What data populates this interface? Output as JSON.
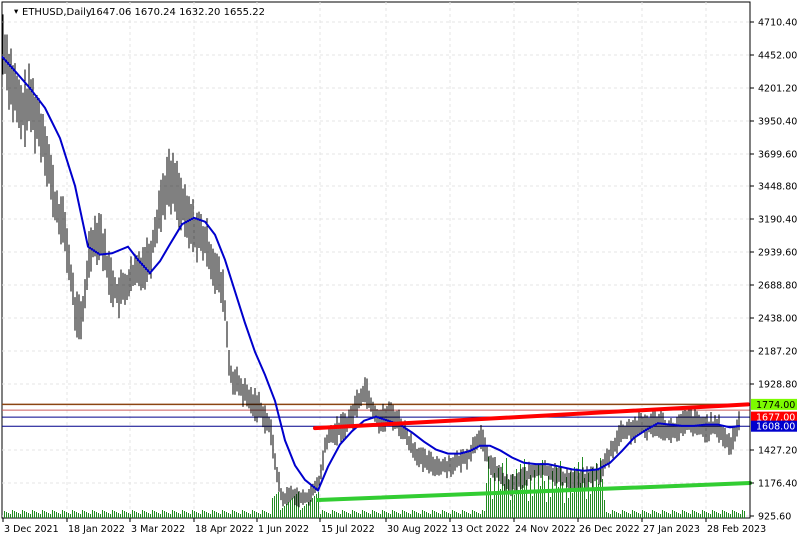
{
  "window": {
    "symbol_label": "ETHUSD,Daily",
    "ohlc": "1647.06 1670.24 1632.20 1655.22"
  },
  "colors": {
    "candle": "#000000",
    "ma": "#0000cd",
    "red_trendline": "#ff0000",
    "green_trendline": "#32cd32",
    "volume": "#228b22",
    "resistance_line": "#8b4513",
    "thin_red_line": "#cd5c5c",
    "blue_line": "#00008b",
    "price_box_green": "#7cfc00",
    "price_box_red": "#ff0000",
    "price_box_blue": "#0000cd",
    "grid": "#e4e4e4"
  },
  "chart_data": {
    "type": "candlestick",
    "title": "ETHUSD,Daily",
    "x_tick_labels": [
      "3 Dec 2021",
      "18 Jan 2022",
      "3 Mar 2022",
      "18 Apr 2022",
      "1 Jun 2022",
      "15 Jul 2022",
      "30 Aug 2022",
      "13 Oct 2022",
      "24 Nov 2022",
      "26 Dec 2022",
      "27 Jan 2023",
      "28 Feb 2023"
    ],
    "y_tick_labels": [
      "4710.40",
      "4452.00",
      "4201.20",
      "3950.40",
      "3699.60",
      "3448.80",
      "3190.40",
      "2939.60",
      "2688.80",
      "2438.00",
      "2187.20",
      "1928.80",
      "1427.20",
      "1176.40",
      "925.60"
    ],
    "ylim": [
      925.6,
      4710.4
    ],
    "price_path": [
      [
        0,
        4650
      ],
      [
        10,
        4300
      ],
      [
        20,
        4000
      ],
      [
        30,
        4100
      ],
      [
        45,
        3800
      ],
      [
        55,
        3300
      ],
      [
        65,
        3100
      ],
      [
        75,
        2500
      ],
      [
        82,
        2400
      ],
      [
        90,
        3000
      ],
      [
        100,
        3100
      ],
      [
        108,
        2800
      ],
      [
        118,
        2600
      ],
      [
        128,
        2700
      ],
      [
        138,
        2800
      ],
      [
        150,
        2900
      ],
      [
        160,
        3300
      ],
      [
        168,
        3500
      ],
      [
        176,
        3450
      ],
      [
        186,
        3200
      ],
      [
        196,
        3100
      ],
      [
        206,
        3000
      ],
      [
        216,
        2800
      ],
      [
        224,
        2600
      ],
      [
        230,
        2000
      ],
      [
        240,
        1900
      ],
      [
        250,
        1800
      ],
      [
        260,
        1750
      ],
      [
        270,
        1600
      ],
      [
        276,
        1300
      ],
      [
        282,
        1050
      ],
      [
        292,
        1100
      ],
      [
        302,
        1050
      ],
      [
        312,
        1100
      ],
      [
        320,
        1200
      ],
      [
        326,
        1500
      ],
      [
        334,
        1550
      ],
      [
        342,
        1600
      ],
      [
        350,
        1650
      ],
      [
        358,
        1800
      ],
      [
        366,
        1900
      ],
      [
        372,
        1750
      ],
      [
        380,
        1650
      ],
      [
        392,
        1700
      ],
      [
        402,
        1600
      ],
      [
        412,
        1450
      ],
      [
        422,
        1350
      ],
      [
        432,
        1320
      ],
      [
        442,
        1300
      ],
      [
        452,
        1320
      ],
      [
        462,
        1350
      ],
      [
        470,
        1400
      ],
      [
        480,
        1550
      ],
      [
        488,
        1350
      ],
      [
        498,
        1250
      ],
      [
        508,
        1150
      ],
      [
        520,
        1200
      ],
      [
        530,
        1250
      ],
      [
        540,
        1280
      ],
      [
        550,
        1270
      ],
      [
        560,
        1220
      ],
      [
        570,
        1210
      ],
      [
        580,
        1200
      ],
      [
        590,
        1220
      ],
      [
        600,
        1250
      ],
      [
        610,
        1400
      ],
      [
        620,
        1550
      ],
      [
        630,
        1580
      ],
      [
        640,
        1600
      ],
      [
        650,
        1620
      ],
      [
        660,
        1640
      ],
      [
        670,
        1560
      ],
      [
        680,
        1600
      ],
      [
        690,
        1650
      ],
      [
        700,
        1600
      ],
      [
        710,
        1600
      ],
      [
        720,
        1580
      ],
      [
        730,
        1450
      ],
      [
        740,
        1650
      ]
    ],
    "moving_average": [
      [
        2,
        4440
      ],
      [
        15,
        4330
      ],
      [
        30,
        4200
      ],
      [
        45,
        4050
      ],
      [
        60,
        3820
      ],
      [
        75,
        3450
      ],
      [
        88,
        2980
      ],
      [
        100,
        2920
      ],
      [
        112,
        2930
      ],
      [
        128,
        2980
      ],
      [
        138,
        2880
      ],
      [
        150,
        2780
      ],
      [
        160,
        2870
      ],
      [
        170,
        3000
      ],
      [
        182,
        3150
      ],
      [
        194,
        3200
      ],
      [
        205,
        3170
      ],
      [
        215,
        3070
      ],
      [
        225,
        2880
      ],
      [
        235,
        2640
      ],
      [
        245,
        2400
      ],
      [
        255,
        2180
      ],
      [
        265,
        2000
      ],
      [
        275,
        1800
      ],
      [
        285,
        1500
      ],
      [
        295,
        1310
      ],
      [
        305,
        1200
      ],
      [
        318,
        1120
      ],
      [
        328,
        1300
      ],
      [
        340,
        1470
      ],
      [
        352,
        1570
      ],
      [
        364,
        1650
      ],
      [
        376,
        1680
      ],
      [
        388,
        1650
      ],
      [
        400,
        1620
      ],
      [
        412,
        1560
      ],
      [
        424,
        1490
      ],
      [
        436,
        1430
      ],
      [
        448,
        1400
      ],
      [
        460,
        1400
      ],
      [
        470,
        1420
      ],
      [
        480,
        1460
      ],
      [
        490,
        1460
      ],
      [
        500,
        1425
      ],
      [
        512,
        1370
      ],
      [
        524,
        1330
      ],
      [
        536,
        1320
      ],
      [
        548,
        1320
      ],
      [
        560,
        1300
      ],
      [
        572,
        1280
      ],
      [
        584,
        1270
      ],
      [
        598,
        1280
      ],
      [
        610,
        1330
      ],
      [
        622,
        1420
      ],
      [
        634,
        1520
      ],
      [
        646,
        1580
      ],
      [
        658,
        1630
      ],
      [
        670,
        1620
      ],
      [
        682,
        1610
      ],
      [
        694,
        1610
      ],
      [
        706,
        1620
      ],
      [
        718,
        1620
      ],
      [
        730,
        1600
      ],
      [
        740,
        1610
      ]
    ],
    "trendlines": [
      {
        "color": "red",
        "from": [
          315,
          1593
        ],
        "to": [
          748,
          1774
        ]
      },
      {
        "color": "green",
        "from": [
          318,
          1047
        ],
        "to": [
          750,
          1176
        ]
      }
    ],
    "horizontal_levels": [
      1774.0,
      1677.0,
      1608.0
    ],
    "price_labels": [
      {
        "value": "1774.00",
        "style": "green"
      },
      {
        "value": "1677.00",
        "style": "red"
      },
      {
        "value": "1608.00",
        "style": "blue"
      }
    ]
  }
}
